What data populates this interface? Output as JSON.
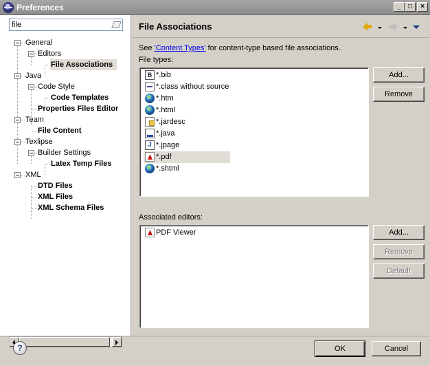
{
  "window": {
    "title": "Preferences",
    "controls": {
      "minimize": "_",
      "maximize": "□",
      "close": "×"
    }
  },
  "filter": {
    "value": "file"
  },
  "tree": {
    "general": "General",
    "editors": "Editors",
    "file_associations": "File Associations",
    "java": "Java",
    "code_style": "Code Style",
    "code_templates": "Code Templates",
    "properties_files_editor": "Properties Files Editor",
    "team": "Team",
    "file_content": "File Content",
    "texlipse": "Texlipse",
    "builder_settings": "Builder Settings",
    "latex_temp_files": "Latex Temp Files",
    "xml": "XML",
    "dtd_files": "DTD Files",
    "xml_files": "XML Files",
    "xml_schema_files": "XML Schema Files"
  },
  "page": {
    "title": "File Associations",
    "see_prefix": "See ",
    "see_link": "'Content Types'",
    "see_suffix": " for content-type based file associations.",
    "file_types_label": "File types:",
    "associated_editors_label": "Associated editors:"
  },
  "file_types": [
    {
      "label": "*.bib",
      "icon": "bib-file-icon"
    },
    {
      "label": "*.class without source",
      "icon": "class-file-icon"
    },
    {
      "label": "*.htm",
      "icon": "web-file-icon"
    },
    {
      "label": "*.html",
      "icon": "web-file-icon"
    },
    {
      "label": "*.jardesc",
      "icon": "jar-desc-file-icon"
    },
    {
      "label": "*.java",
      "icon": "java-file-icon"
    },
    {
      "label": "*.jpage",
      "icon": "jpage-file-icon"
    },
    {
      "label": "*.pdf",
      "icon": "pdf-file-icon",
      "selected": true
    },
    {
      "label": "*.shtml",
      "icon": "web-file-icon"
    }
  ],
  "editors": [
    {
      "label": "PDF Viewer",
      "icon": "pdf-file-icon"
    }
  ],
  "buttons": {
    "file_add": "Add...",
    "file_remove": "Remove",
    "editor_add": "Add...",
    "editor_remove": "Remove",
    "editor_default": "Default",
    "ok": "OK",
    "cancel": "Cancel"
  },
  "icons": {
    "bib_glyph": "B",
    "jpage_glyph": "J",
    "help_glyph": "?"
  },
  "colors": {
    "dialog_bg": "#d4d0c8",
    "title_bar": "#9a9a9a",
    "link": "#0000ee",
    "selection": "#e1ddd6"
  }
}
